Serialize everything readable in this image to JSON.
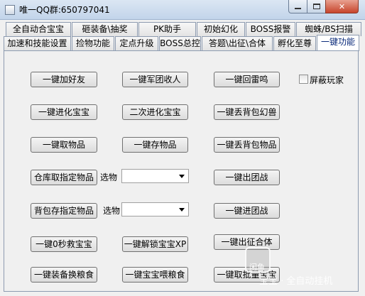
{
  "window": {
    "title": "唯一QQ群:650797041"
  },
  "tabs_row1": [
    "全自动合宝宝",
    "砸装备\\抽奖",
    "PK助手",
    "初始幻化",
    "BOSS报警",
    "蜘蛛/BS扫描"
  ],
  "tabs_row2": [
    "加速和技能设置",
    "捡物功能",
    "定点升级",
    "BOSS总控",
    "答题\\出征\\合体",
    "孵化至尊",
    "一键功能"
  ],
  "active_tab": "一键功能",
  "buttons": {
    "add_friend": "一键加好友",
    "recruit_team": "一键军团收人",
    "recall_lei": "一键回雷鸣",
    "evolve_pet": "一键进化宝宝",
    "second_evolve": "二次进化宝宝",
    "drop_bag_illusion": "一键丢背包幻兽",
    "take_items": "一键取物品",
    "store_items": "一键存物品",
    "drop_bag_items": "一键丢背包物品",
    "warehouse_take": "仓库取指定物品",
    "exit_group_battle": "一键出团战",
    "bag_store": "背包存指定物品",
    "enter_group_battle": "一键进团战",
    "zero_sec_save": "一键0秒救宝宝",
    "unlock_pet_xp": "一键解锁宝宝XP",
    "expedition_merge": "一键出征合体",
    "equip_food": "一键装备换粮食",
    "feed_pet": "一键宝宝喂粮食",
    "batch_take": "一键取批量宝宝"
  },
  "select_label_1": "选物",
  "select_label_2": "选物",
  "select_value_1": "",
  "select_value_2": "",
  "checkbox": {
    "label": "屏蔽玩家",
    "checked": false
  },
  "watermark": {
    "logo": "闲鱼",
    "text": "宝宝 · 全自动挂机"
  }
}
